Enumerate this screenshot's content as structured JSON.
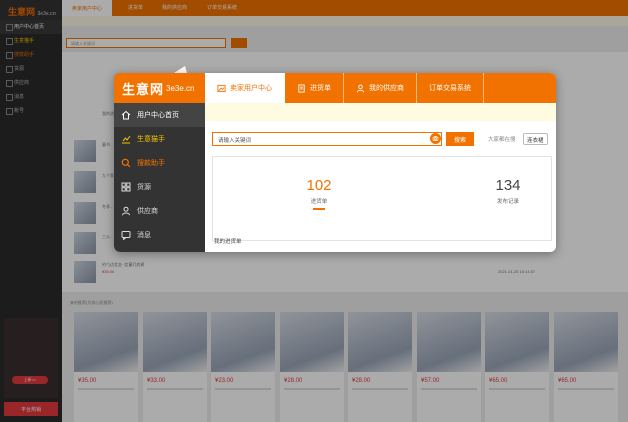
{
  "background": {
    "logo_cn": "生意网",
    "logo_en": "3e3e.cn",
    "sidebar": [
      "用户中心首页",
      "生意猫手",
      "搜款助手",
      "货源",
      "供应商",
      "消息",
      "账号"
    ],
    "top_tabs": [
      "卖家用户中心",
      "进货单",
      "我的供应商",
      "订单交易系统"
    ],
    "search_placeholder": "请输入关键词",
    "section_label": "我的进货单",
    "grid_label": "来的推荐(为你心愿推荐)",
    "row_items": [
      {
        "title": "童书...",
        "date": ""
      },
      {
        "title": "九个家...",
        "date": ""
      },
      {
        "title": "冬季...",
        "date": ""
      },
      {
        "title": "三公...",
        "date": ""
      },
      {
        "title": "钓勺边北金~女童打底裤",
        "price": "¥35.00",
        "date": "2021-01-25 16:14:57"
      }
    ],
    "grid_prices": [
      "¥35.00",
      "¥33.00",
      "¥23.00",
      "¥28.00",
      "¥28.00",
      "¥57.00",
      "¥65.00",
      "¥65.00"
    ],
    "ad_button": "上新>>",
    "ad_bottom": "平台热销"
  },
  "popup": {
    "logo_cn": "生意网",
    "logo_en": "3e3e.cn",
    "sidebar": [
      {
        "label": "用户中心首页",
        "icon": "home-icon",
        "state": "active"
      },
      {
        "label": "生意猫手",
        "icon": "chart-icon",
        "state": "yellow"
      },
      {
        "label": "搜款助手",
        "icon": "search-icon",
        "state": "orange"
      },
      {
        "label": "货源",
        "icon": "grid-icon",
        "state": "normal"
      },
      {
        "label": "供应商",
        "icon": "user-icon",
        "state": "normal"
      },
      {
        "label": "消息",
        "icon": "message-icon",
        "state": "normal"
      }
    ],
    "tabs": [
      {
        "label": "卖家用户中心",
        "icon": "photo-icon",
        "active": true
      },
      {
        "label": "进货单",
        "icon": "document-icon",
        "active": false
      },
      {
        "label": "我的供应商",
        "icon": "user-icon",
        "active": false
      },
      {
        "label": "订单交易系统",
        "icon": "",
        "active": false
      }
    ],
    "search": {
      "placeholder": "请输入关键词",
      "button": "搜索",
      "hot_label": "大家都在搜",
      "hot_chip": "连衣裙"
    },
    "stats": [
      {
        "value": "102",
        "label": "进货单"
      },
      {
        "value": "134",
        "label": "发布记录"
      }
    ],
    "section_label": "我的进货单"
  },
  "colors": {
    "accent": "#f27200",
    "sidebar_bg": "#333333",
    "price_red": "#e4393c"
  }
}
